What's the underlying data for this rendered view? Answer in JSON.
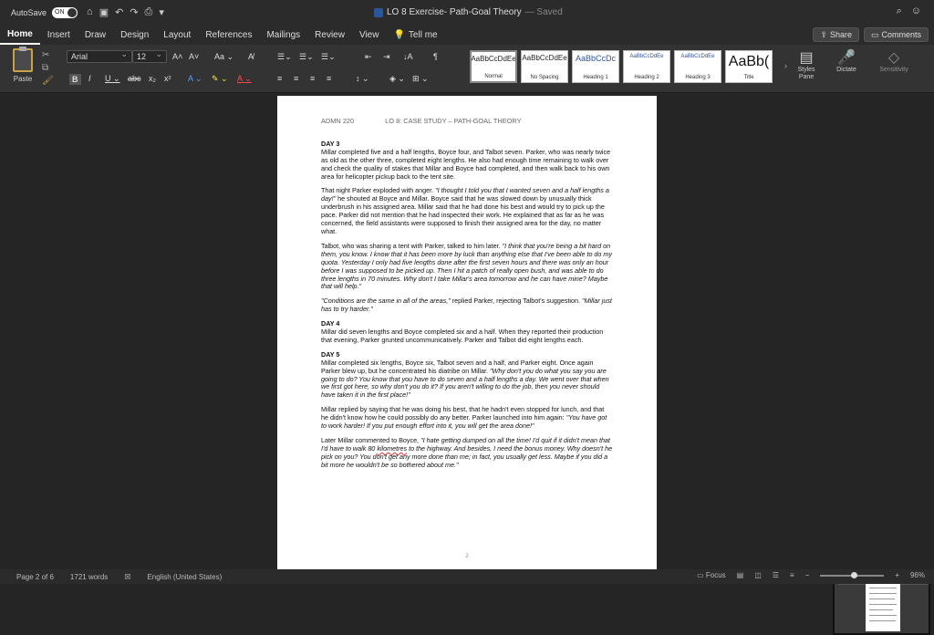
{
  "titlebar": {
    "autosave_label": "AutoSave",
    "autosave_state": "ON",
    "doc_title": "LO 8 Exercise- Path-Goal Theory",
    "saved_status": "— Saved",
    "home_icon": "home-icon",
    "save_icon": "save-icon",
    "undo_icon": "undo-icon",
    "redo_icon": "redo-icon",
    "print_icon": "print-icon"
  },
  "tabs": [
    "Home",
    "Insert",
    "Draw",
    "Design",
    "Layout",
    "References",
    "Mailings",
    "Review",
    "View",
    "Tell me"
  ],
  "share": {
    "label": "Share"
  },
  "comments": {
    "label": "Comments"
  },
  "ribbon": {
    "paste_label": "Paste",
    "font_name": "Arial",
    "font_size": "12",
    "styles": [
      {
        "sample": "AaBbCcDdEe",
        "name": "Normal"
      },
      {
        "sample": "AaBbCcDdEe",
        "name": "No Spacing"
      },
      {
        "sample": "AaBbCcDc",
        "name": "Heading 1"
      },
      {
        "sample": "AaBbCcDdEe",
        "name": "Heading 2"
      },
      {
        "sample": "AaBbCcDdEe",
        "name": "Heading 3"
      },
      {
        "sample": "AaBb(",
        "name": "Title"
      }
    ],
    "styles_pane": "Styles Pane",
    "dictate": "Dictate",
    "sensitivity": "Sensitivity"
  },
  "document": {
    "course": "ADMN 220",
    "heading": "LO 8:  CASE STUDY – PATH-GOAL THEORY",
    "day3_title": "DAY 3",
    "day3_p1": "Millar completed five and a half lengths, Boyce four, and Talbot seven. Parker, who was nearly twice as old as the other three, completed eight lengths. He also had enough time remaining to walk over and check the quality of stakes that Millar and Boyce had completed, and then walk back to his own area for helicopter pickup back to the tent site.",
    "day3_p2a": "That night Parker exploded with anger. ",
    "day3_p2b": "\"I thought I told you that I wanted seven and a half lengths a day!\"",
    "day3_p2c": " he shouted at Boyce and Millar. Boyce said that he was slowed down by unusually thick underbrush in his assigned area. Millar said that he had done his best and would try to pick up the pace. Parker did not mention that he had inspected their work. He explained that as far as he was concerned, the field assistants were supposed to finish their assigned area for the day, no matter what.",
    "day3_p3a": "Talbot, who was sharing a tent with Parker, talked to him later. ",
    "day3_p3b": "\"I think that you're being a bit hard on them, you know. I know that it has been more by luck than anything else that I've been able to do my quota. Yesterday I only had five lengths done after the first seven hours and there was only an hour before I was supposed to be picked up. Then I hit a patch of really open bush, and was able to do three lengths in 70 minutes. Why don't I take Millar's area tomorrow and he can have mine? Maybe that will help.\"",
    "day3_p4a": "\"Conditions are the same in all of the areas,\"",
    "day3_p4b": " replied Parker, rejecting Talbot's suggestion. ",
    "day3_p4c": "\"Millar just has to try harder.\"",
    "day4_title": "DAY 4",
    "day4_p1": "Millar did seven lengths and Boyce completed six and a half. When they reported their production that evening, Parker grunted uncommunicatively. Parker and Talbot did eight lengths each.",
    "day5_title": "DAY 5",
    "day5_p1a": "Millar completed six lengths, Boyce six, Talbot seven and a half, and Parker eight. Once again Parker blew up, but he concentrated his diatribe on Millar. ",
    "day5_p1b": "\"Why don't you do what you say you are going to do? You know that you have to do seven and a half lengths a day. We went over that when we first got here, so why don't you do it? If you aren't willing to do the job, then you never should have taken it in the first place!\"",
    "day5_p2a": "Millar replied by saying that he was doing his best, that he hadn't even stopped for lunch, and that he didn't know how he could possibly do any better. Parker launched into him again: ",
    "day5_p2b": "\"You have got to work harder! If you put enough effort into it, you will get the area done!\"",
    "day5_p3a": "Later Millar commented to Boyce, ",
    "day5_p3b": "\"I hate getting dumped on all the time! I'd quit if it didn't mean that I'd have to walk 80 ",
    "day5_p3c": "kilometres",
    "day5_p3d": " to the highway. And besides, I need the bonus money. Why doesn't he pick on you? You don't get any more done than me; in fact, you usually get less. Maybe if you did a bit more he wouldn't be so bothered about me.\"",
    "page_number": "2"
  },
  "status": {
    "page": "Page 2 of 6",
    "words": "1721 words",
    "language": "English (United States)",
    "focus": "Focus",
    "zoom": "96%"
  }
}
